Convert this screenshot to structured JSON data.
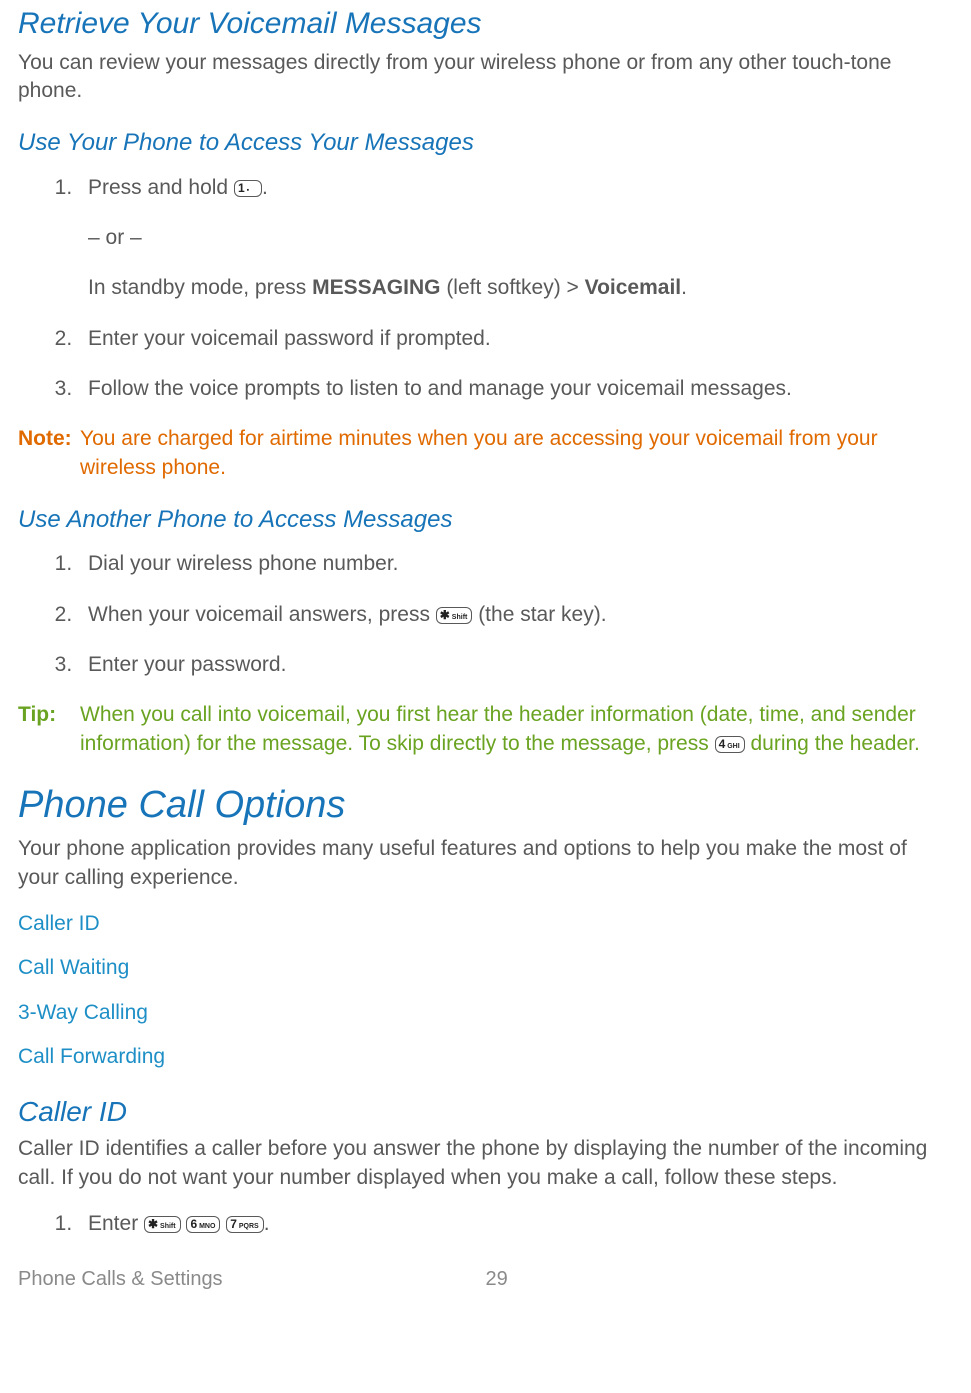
{
  "headings": {
    "retrieve": "Retrieve Your Voicemail Messages",
    "retrieve_intro": "You can review your messages directly from your wireless phone or from any other touch-tone phone.",
    "use_your_phone": "Use Your Phone to Access Your Messages",
    "use_another": "Use Another Phone to Access Messages",
    "phone_options": "Phone Call Options",
    "phone_options_intro": "Your phone application provides many useful features and options to help you make the most of your calling experience.",
    "caller_id_h": "Caller ID",
    "caller_id_intro": "Caller ID identifies a caller before you answer the phone by displaying the number of the incoming call. If you do not want your number displayed when you make a call, follow these steps."
  },
  "steps_a": {
    "s1a": "Press and hold ",
    "s1b": ".",
    "s1or": "– or –",
    "s1c_a": "In standby mode, press ",
    "s1c_b": "MESSAGING",
    "s1c_c": " (left softkey) > ",
    "s1c_d": "Voicemail",
    "s1c_e": ".",
    "s2": "Enter your voicemail password if prompted.",
    "s3": "Follow the voice prompts to listen to and manage your voicemail messages."
  },
  "note": {
    "label": "Note:",
    "body": "You are charged for airtime minutes when you are accessing your voicemail from your wireless phone."
  },
  "steps_b": {
    "s1": "Dial your wireless phone number.",
    "s2a": "When your voicemail answers, press ",
    "s2b": " (the star key).",
    "s3": "Enter your password."
  },
  "tip": {
    "label": "Tip:",
    "body_a": "When you call into voicemail, you first hear the header information (date, time, and sender information) for the message. To skip directly to the message, press ",
    "body_b": " during the header."
  },
  "links": {
    "l1": "Caller ID",
    "l2": "Call Waiting",
    "l3": "3-Way Calling",
    "l4": "Call Forwarding"
  },
  "steps_c": {
    "s1a": "Enter ",
    "s1b": "."
  },
  "keys": {
    "one": "1 ▪",
    "star": "✱ Shift",
    "four": "4 GHI",
    "six": "6 MNO",
    "seven": "7 PQRS"
  },
  "footer": {
    "section": "Phone Calls & Settings",
    "page": "29"
  }
}
